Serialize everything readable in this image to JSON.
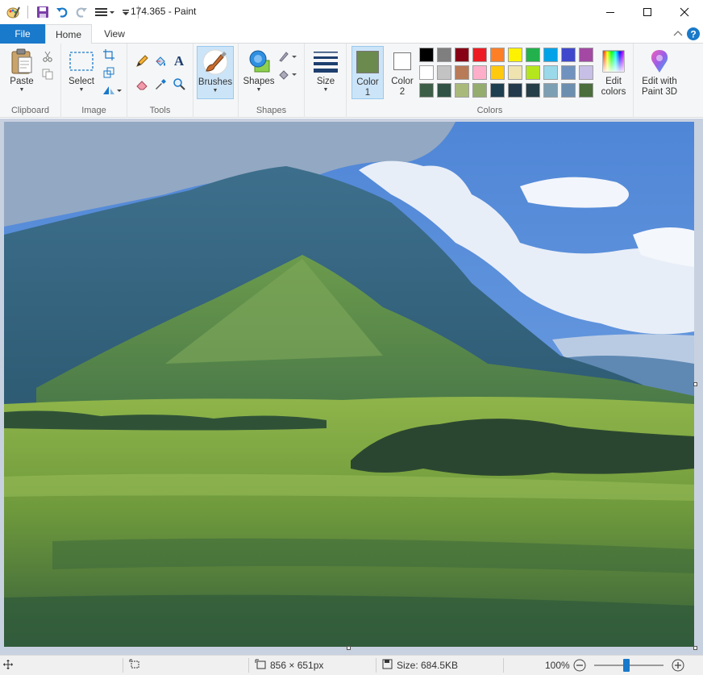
{
  "window": {
    "title": "174.365 - Paint"
  },
  "tabs": [
    {
      "label": "File"
    },
    {
      "label": "Home"
    },
    {
      "label": "View"
    }
  ],
  "ribbon": {
    "clipboard": {
      "paste_label": "Paste",
      "group_label": "Clipboard"
    },
    "image": {
      "select_label": "Select",
      "group_label": "Image"
    },
    "tools": {
      "group_label": "Tools",
      "text_glyph": "A"
    },
    "brushes": {
      "label": "Brushes"
    },
    "shapes": {
      "label": "Shapes",
      "group_label": "Shapes"
    },
    "size": {
      "label": "Size"
    },
    "color1": {
      "label_line1": "Color",
      "label_line2": "1",
      "color": "#6b8a4e"
    },
    "color2": {
      "label_line1": "Color",
      "label_line2": "2",
      "color": "#ffffff"
    },
    "colors": {
      "group_label": "Colors",
      "row1": [
        "#000000",
        "#7f7f7f",
        "#880015",
        "#ed1c24",
        "#ff7f27",
        "#fff200",
        "#22b14c",
        "#00a2e8",
        "#3f48cc",
        "#a349a4"
      ],
      "row2": [
        "#ffffff",
        "#c3c3c3",
        "#b97a57",
        "#ffaec9",
        "#ffc90e",
        "#efe4b0",
        "#b5e61d",
        "#99d9ea",
        "#7092be",
        "#c8bfe7"
      ],
      "row3": [
        "#3d5e46",
        "#2f5245",
        "#a9b97a",
        "#94ad6e",
        "#1e3f4f",
        "#223a4c",
        "#263e48",
        "#7d9fb3",
        "#6c8fb0",
        "#4b6e3c"
      ]
    },
    "edit_colors": {
      "line1": "Edit",
      "line2": "colors"
    },
    "edit_3d": {
      "line1": "Edit with",
      "line2": "Paint 3D"
    }
  },
  "statusbar": {
    "dimensions": "856 × 651px",
    "size": "Size: 684.5KB",
    "zoom": "100%",
    "zoom_fraction": 0.47
  }
}
